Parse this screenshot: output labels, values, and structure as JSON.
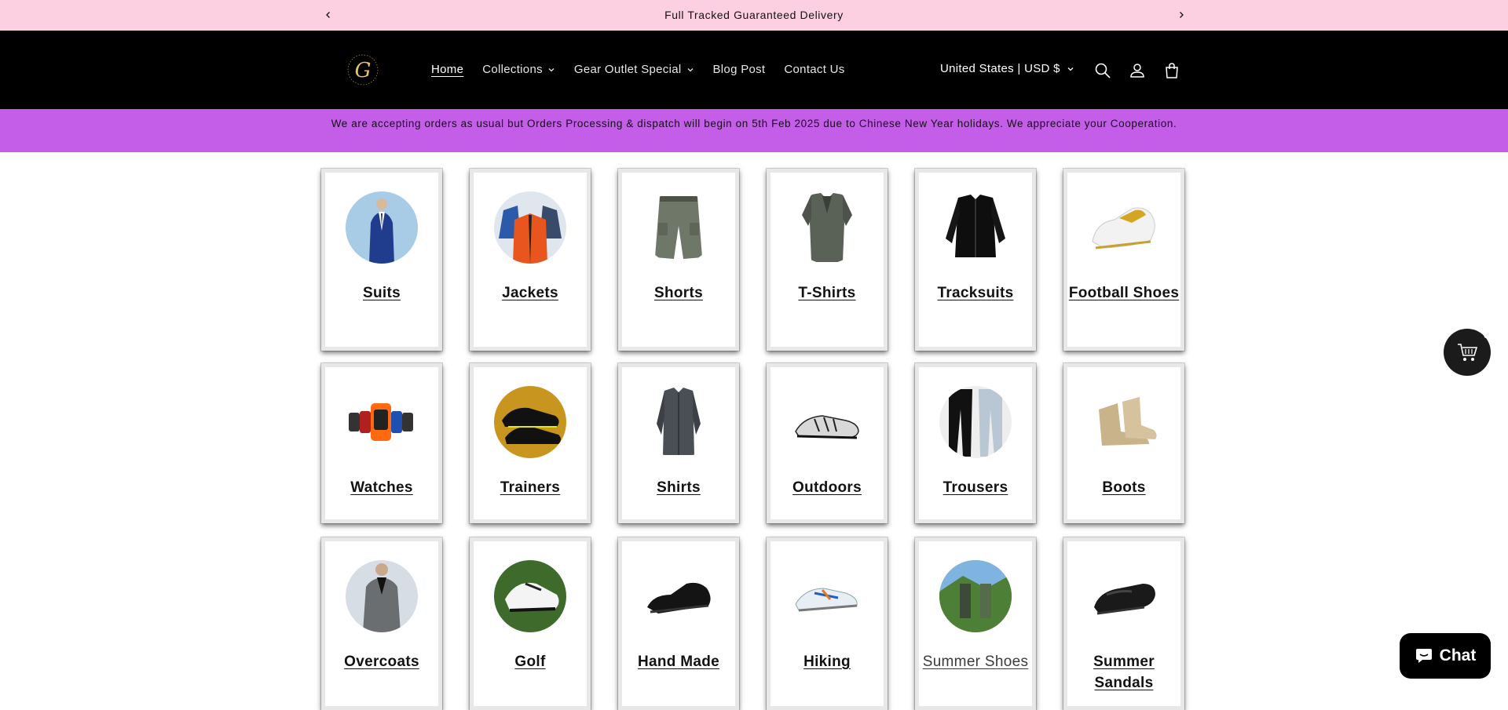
{
  "announcement": {
    "text": "Full Tracked Guaranteed Delivery"
  },
  "header": {
    "logo_icon": "gear-outlet-logo",
    "nav": [
      {
        "label": "Home",
        "active": true,
        "dropdown": false
      },
      {
        "label": "Collections",
        "active": false,
        "dropdown": true
      },
      {
        "label": "Gear Outlet Special",
        "active": false,
        "dropdown": true
      },
      {
        "label": "Blog Post",
        "active": false,
        "dropdown": false
      },
      {
        "label": "Contact Us",
        "active": false,
        "dropdown": false
      }
    ],
    "country": "United States | USD $",
    "icons": [
      "search-icon",
      "account-icon",
      "cart-icon"
    ]
  },
  "notice": {
    "text": "We are accepting orders as usual but Orders Processing & dispatch will begin on 5th Feb 2025 due to Chinese New Year holidays. We appreciate your Cooperation."
  },
  "categories": [
    {
      "label": "Suits",
      "icon": "suit-image"
    },
    {
      "label": "Jackets",
      "icon": "jackets-image"
    },
    {
      "label": "Shorts",
      "icon": "shorts-image"
    },
    {
      "label": "T-Shirts",
      "icon": "tshirt-image"
    },
    {
      "label": "Tracksuits",
      "icon": "tracksuit-image"
    },
    {
      "label": "Football Shoes",
      "icon": "football-shoes-image"
    },
    {
      "label": "Watches",
      "icon": "watches-image"
    },
    {
      "label": "Trainers",
      "icon": "trainers-image"
    },
    {
      "label": "Shirts",
      "icon": "shirts-image"
    },
    {
      "label": "Outdoors",
      "icon": "outdoors-image"
    },
    {
      "label": "Trousers",
      "icon": "trousers-image"
    },
    {
      "label": "Boots",
      "icon": "boots-image"
    },
    {
      "label": "Overcoats",
      "icon": "overcoat-image"
    },
    {
      "label": "Golf",
      "icon": "golf-image"
    },
    {
      "label": "Hand Made",
      "icon": "hand-made-image"
    },
    {
      "label": "Hiking",
      "icon": "hiking-image"
    },
    {
      "label": "Summer Shoes",
      "icon": "summer-shoes-image"
    },
    {
      "label": "Summer Sandals",
      "icon": "summer-sandals-image"
    }
  ],
  "floating_cart": {
    "count": "0",
    "icon": "cart-icon"
  },
  "chat": {
    "label": "Chat",
    "icon": "chat-bubble-icon"
  }
}
